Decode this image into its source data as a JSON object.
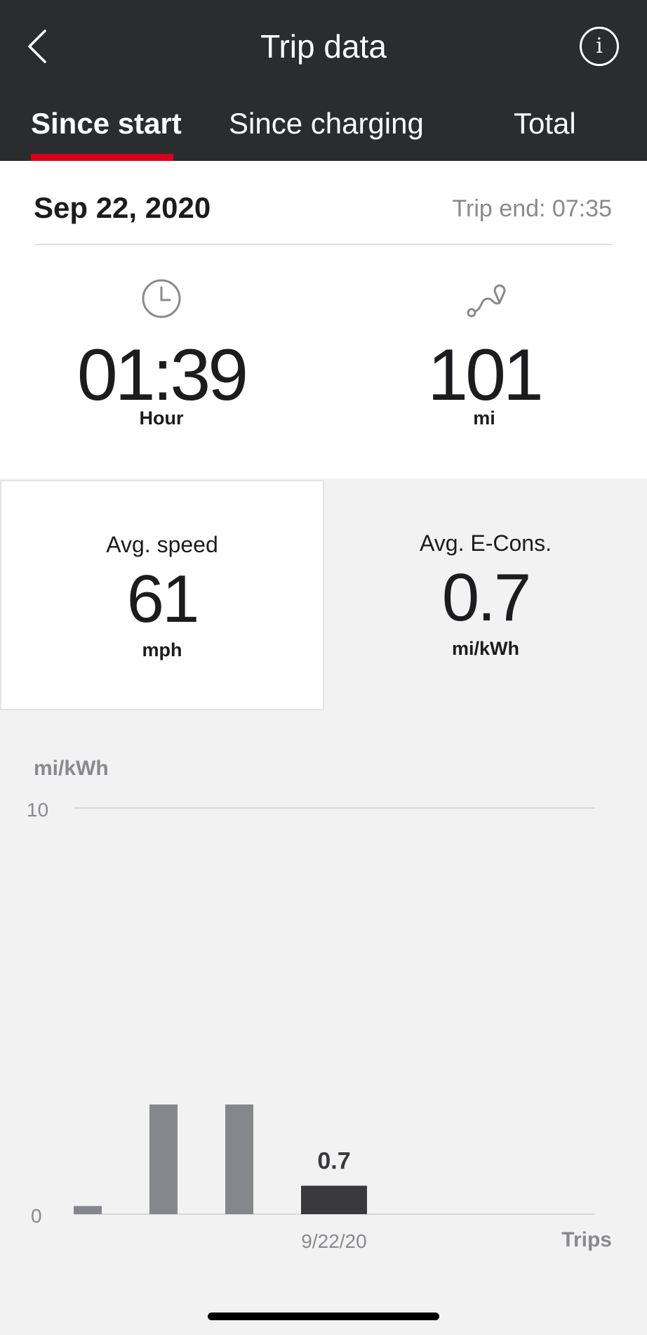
{
  "header": {
    "title": "Trip data",
    "tabs": [
      {
        "label": "Since start",
        "active": true
      },
      {
        "label": "Since charging",
        "active": false
      },
      {
        "label": "Total",
        "active": false
      }
    ]
  },
  "trip": {
    "date": "Sep 22, 2020",
    "trip_end": "Trip end: 07:35",
    "duration": {
      "value": "01:39",
      "unit": "Hour",
      "icon": "clock-icon"
    },
    "distance": {
      "value": "101",
      "unit": "mi",
      "icon": "route-icon"
    }
  },
  "averages": {
    "speed": {
      "label": "Avg. speed",
      "value": "61",
      "unit": "mph"
    },
    "econs": {
      "label": "Avg. E-Cons.",
      "value": "0.7",
      "unit": "mi/kWh"
    }
  },
  "colors": {
    "accent": "#d5001c",
    "header_bg": "#2b2c2e",
    "bar_inactive": "#86878c",
    "bar_active": "#39393c"
  },
  "chart_data": {
    "type": "bar",
    "ylabel": "mi/kWh",
    "xlabel": "Trips",
    "ylim": [
      0,
      10
    ],
    "y_ticks": [
      "0",
      "10"
    ],
    "values": [
      0.2,
      2.7,
      2.7,
      0.7
    ],
    "selected_index": 3,
    "selected_value_label": "0.7",
    "selected_tick_label": "9/22/20"
  }
}
